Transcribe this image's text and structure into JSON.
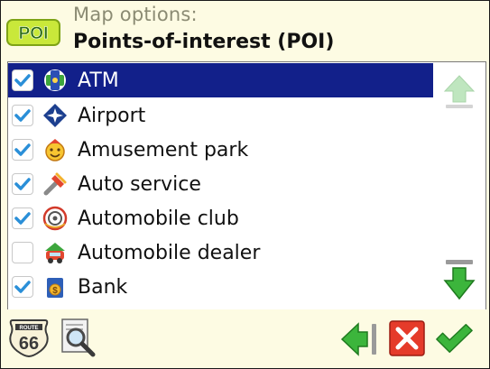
{
  "header": {
    "subtitle": "Map options:",
    "title": "Points-of-interest (POI)",
    "logo_text": "POI"
  },
  "list": {
    "items": [
      {
        "label": "ATM",
        "checked": true,
        "selected": true,
        "icon": "atm-icon"
      },
      {
        "label": "Airport",
        "checked": true,
        "selected": false,
        "icon": "airport-icon"
      },
      {
        "label": "Amusement park",
        "checked": true,
        "selected": false,
        "icon": "amusement-park-icon"
      },
      {
        "label": "Auto service",
        "checked": true,
        "selected": false,
        "icon": "auto-service-icon"
      },
      {
        "label": "Automobile club",
        "checked": true,
        "selected": false,
        "icon": "automobile-club-icon"
      },
      {
        "label": "Automobile dealer",
        "checked": false,
        "selected": false,
        "icon": "automobile-dealer-icon"
      },
      {
        "label": "Bank",
        "checked": true,
        "selected": false,
        "icon": "bank-icon"
      }
    ]
  },
  "footer": {
    "route_sign_top": "ROUTE",
    "route_sign_number": "66"
  },
  "colors": {
    "selection": "#12208a",
    "background": "#fdfbe3",
    "check": "#2a8fd8",
    "confirm": "#3cb53c",
    "cancel": "#e53b2a"
  }
}
